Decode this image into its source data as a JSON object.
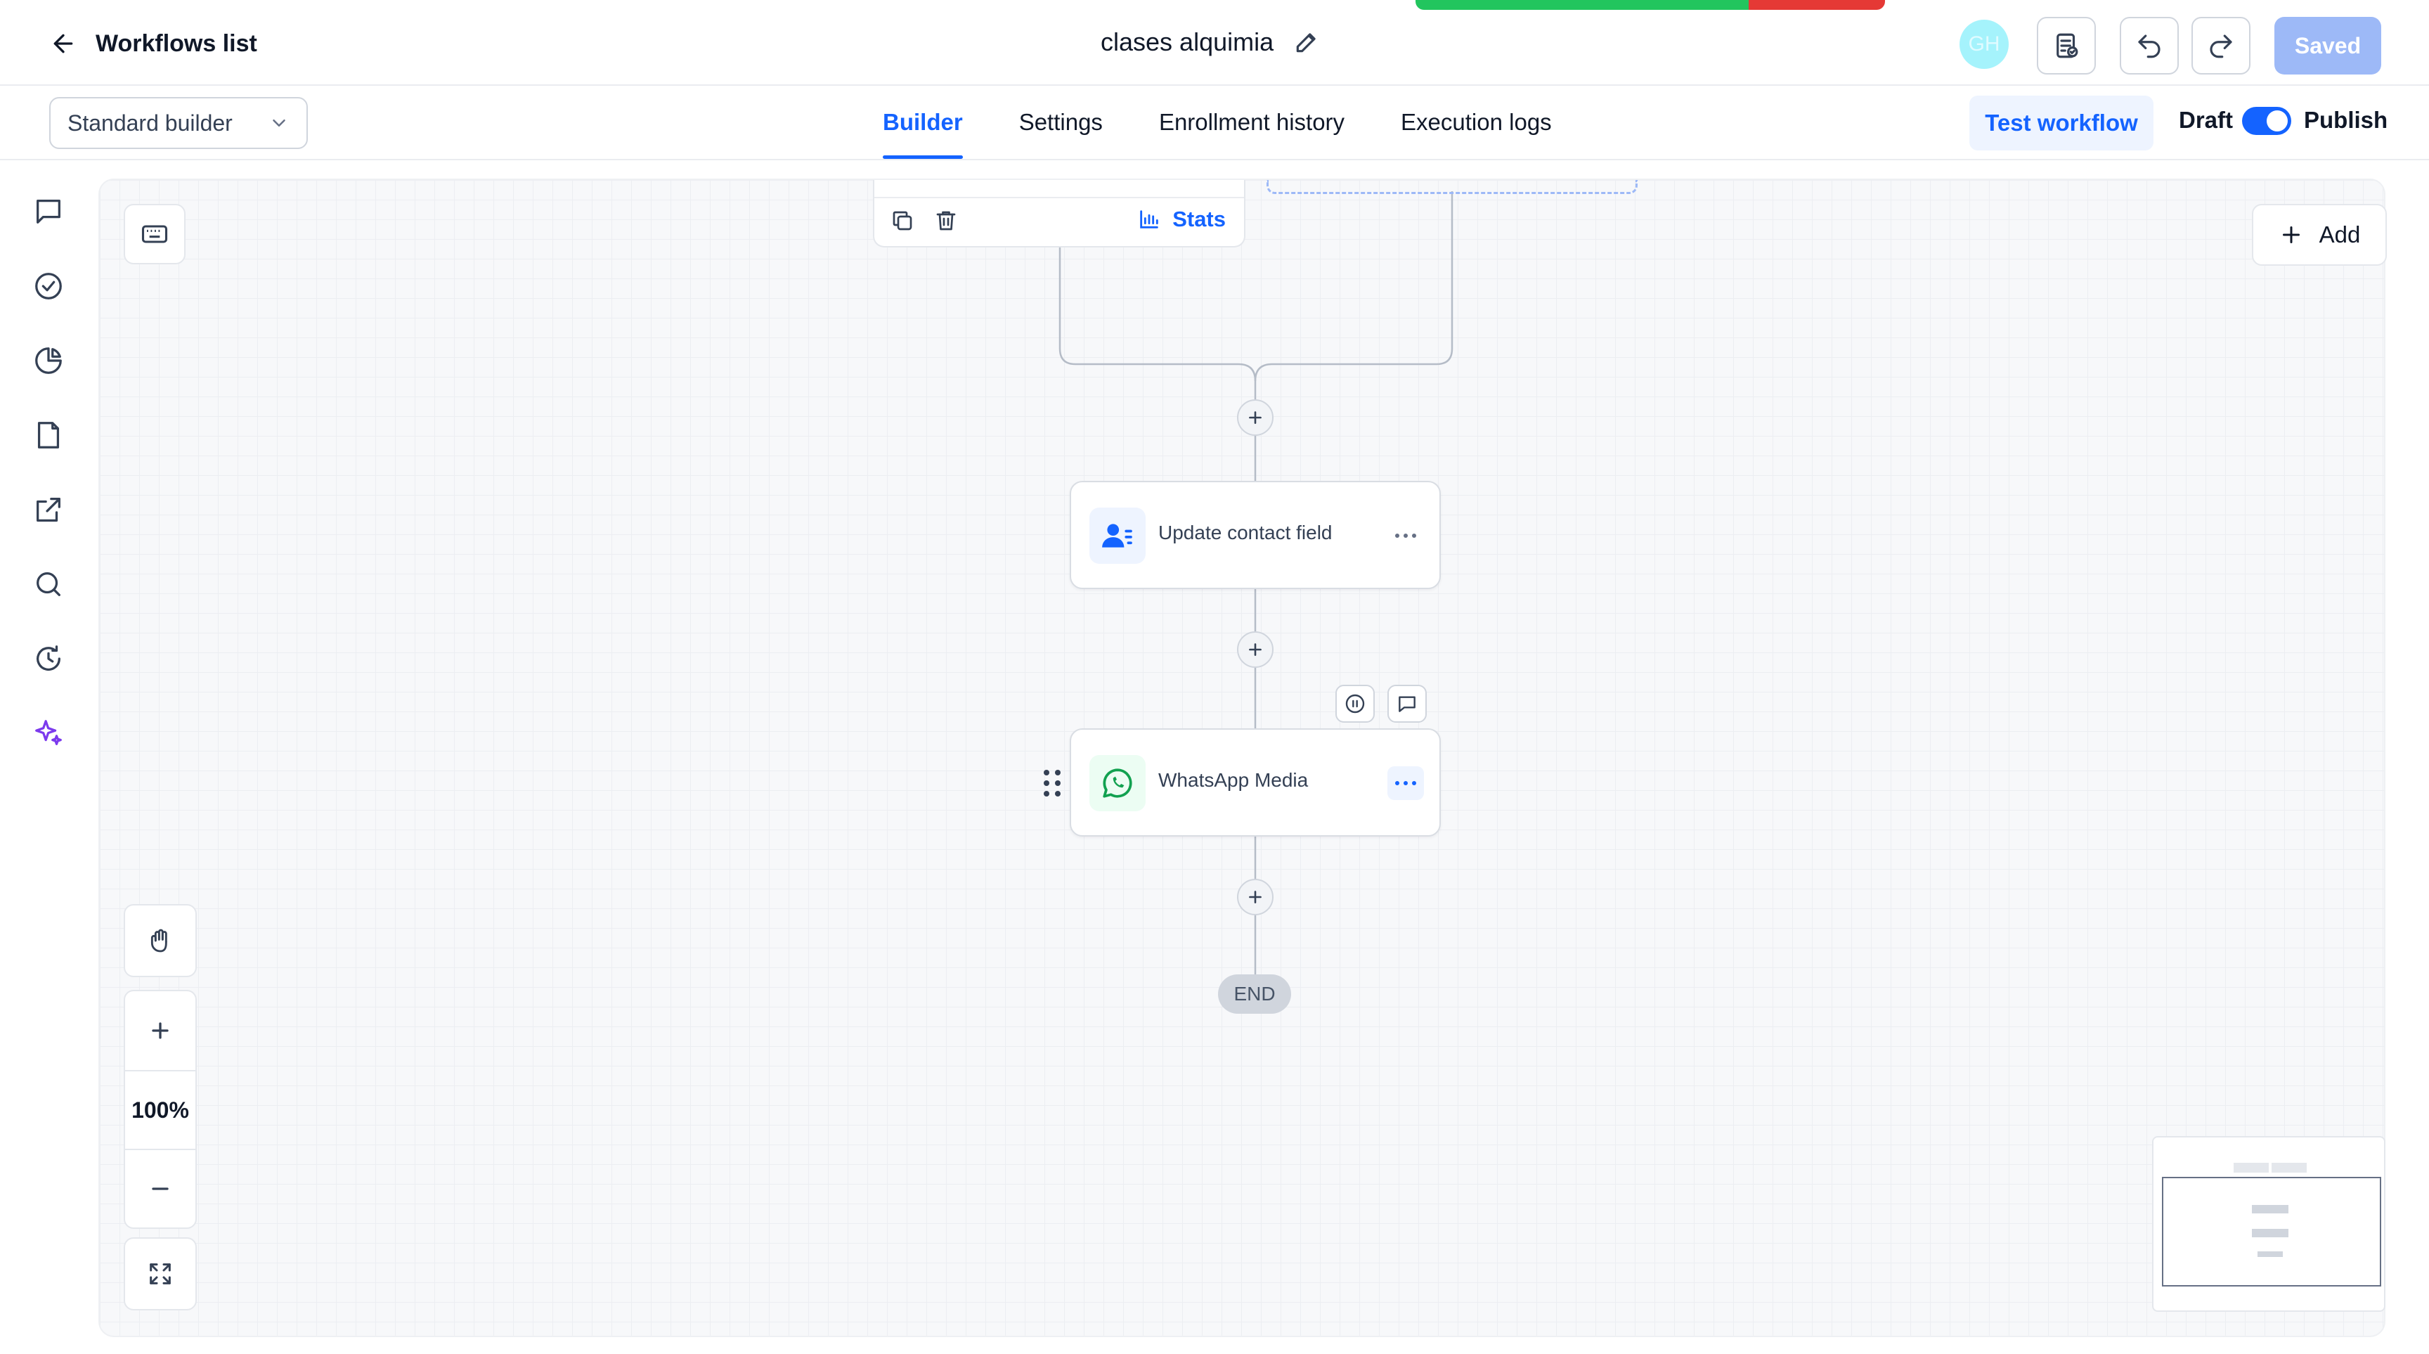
{
  "header": {
    "back_label": "Workflows list",
    "workflow_title": "clases alquimia",
    "avatar_initials": "GH",
    "saved_label": "Saved"
  },
  "tabbar": {
    "builder_mode": "Standard builder",
    "tabs": [
      {
        "label": "Builder",
        "active": true
      },
      {
        "label": "Settings",
        "active": false
      },
      {
        "label": "Enrollment history",
        "active": false
      },
      {
        "label": "Execution logs",
        "active": false
      }
    ],
    "test_label": "Test workflow",
    "draft_label": "Draft",
    "publish_label": "Publish",
    "publish_on": true
  },
  "sidebar": {
    "items": [
      {
        "icon": "chat-bubble-icon"
      },
      {
        "icon": "check-circle-icon"
      },
      {
        "icon": "pie-chart-icon"
      },
      {
        "icon": "document-icon"
      },
      {
        "icon": "external-link-icon"
      },
      {
        "icon": "search-icon"
      },
      {
        "icon": "history-icon"
      },
      {
        "icon": "sparkles-icon"
      }
    ]
  },
  "canvas": {
    "add_label": "Add",
    "top_node": {
      "stats_label": "Stats"
    },
    "nodes": [
      {
        "label": "Update contact field",
        "icon": "contact-icon",
        "accent": "#1463ff"
      },
      {
        "label": "WhatsApp Media",
        "icon": "whatsapp-icon",
        "accent": "#12a150"
      }
    ],
    "end_label": "END",
    "zoom_level": "100%"
  },
  "colors": {
    "primary": "#1463ff",
    "saved_button": "#9db9f7",
    "toast_success": "#22c55e",
    "toast_error": "#e53935"
  }
}
